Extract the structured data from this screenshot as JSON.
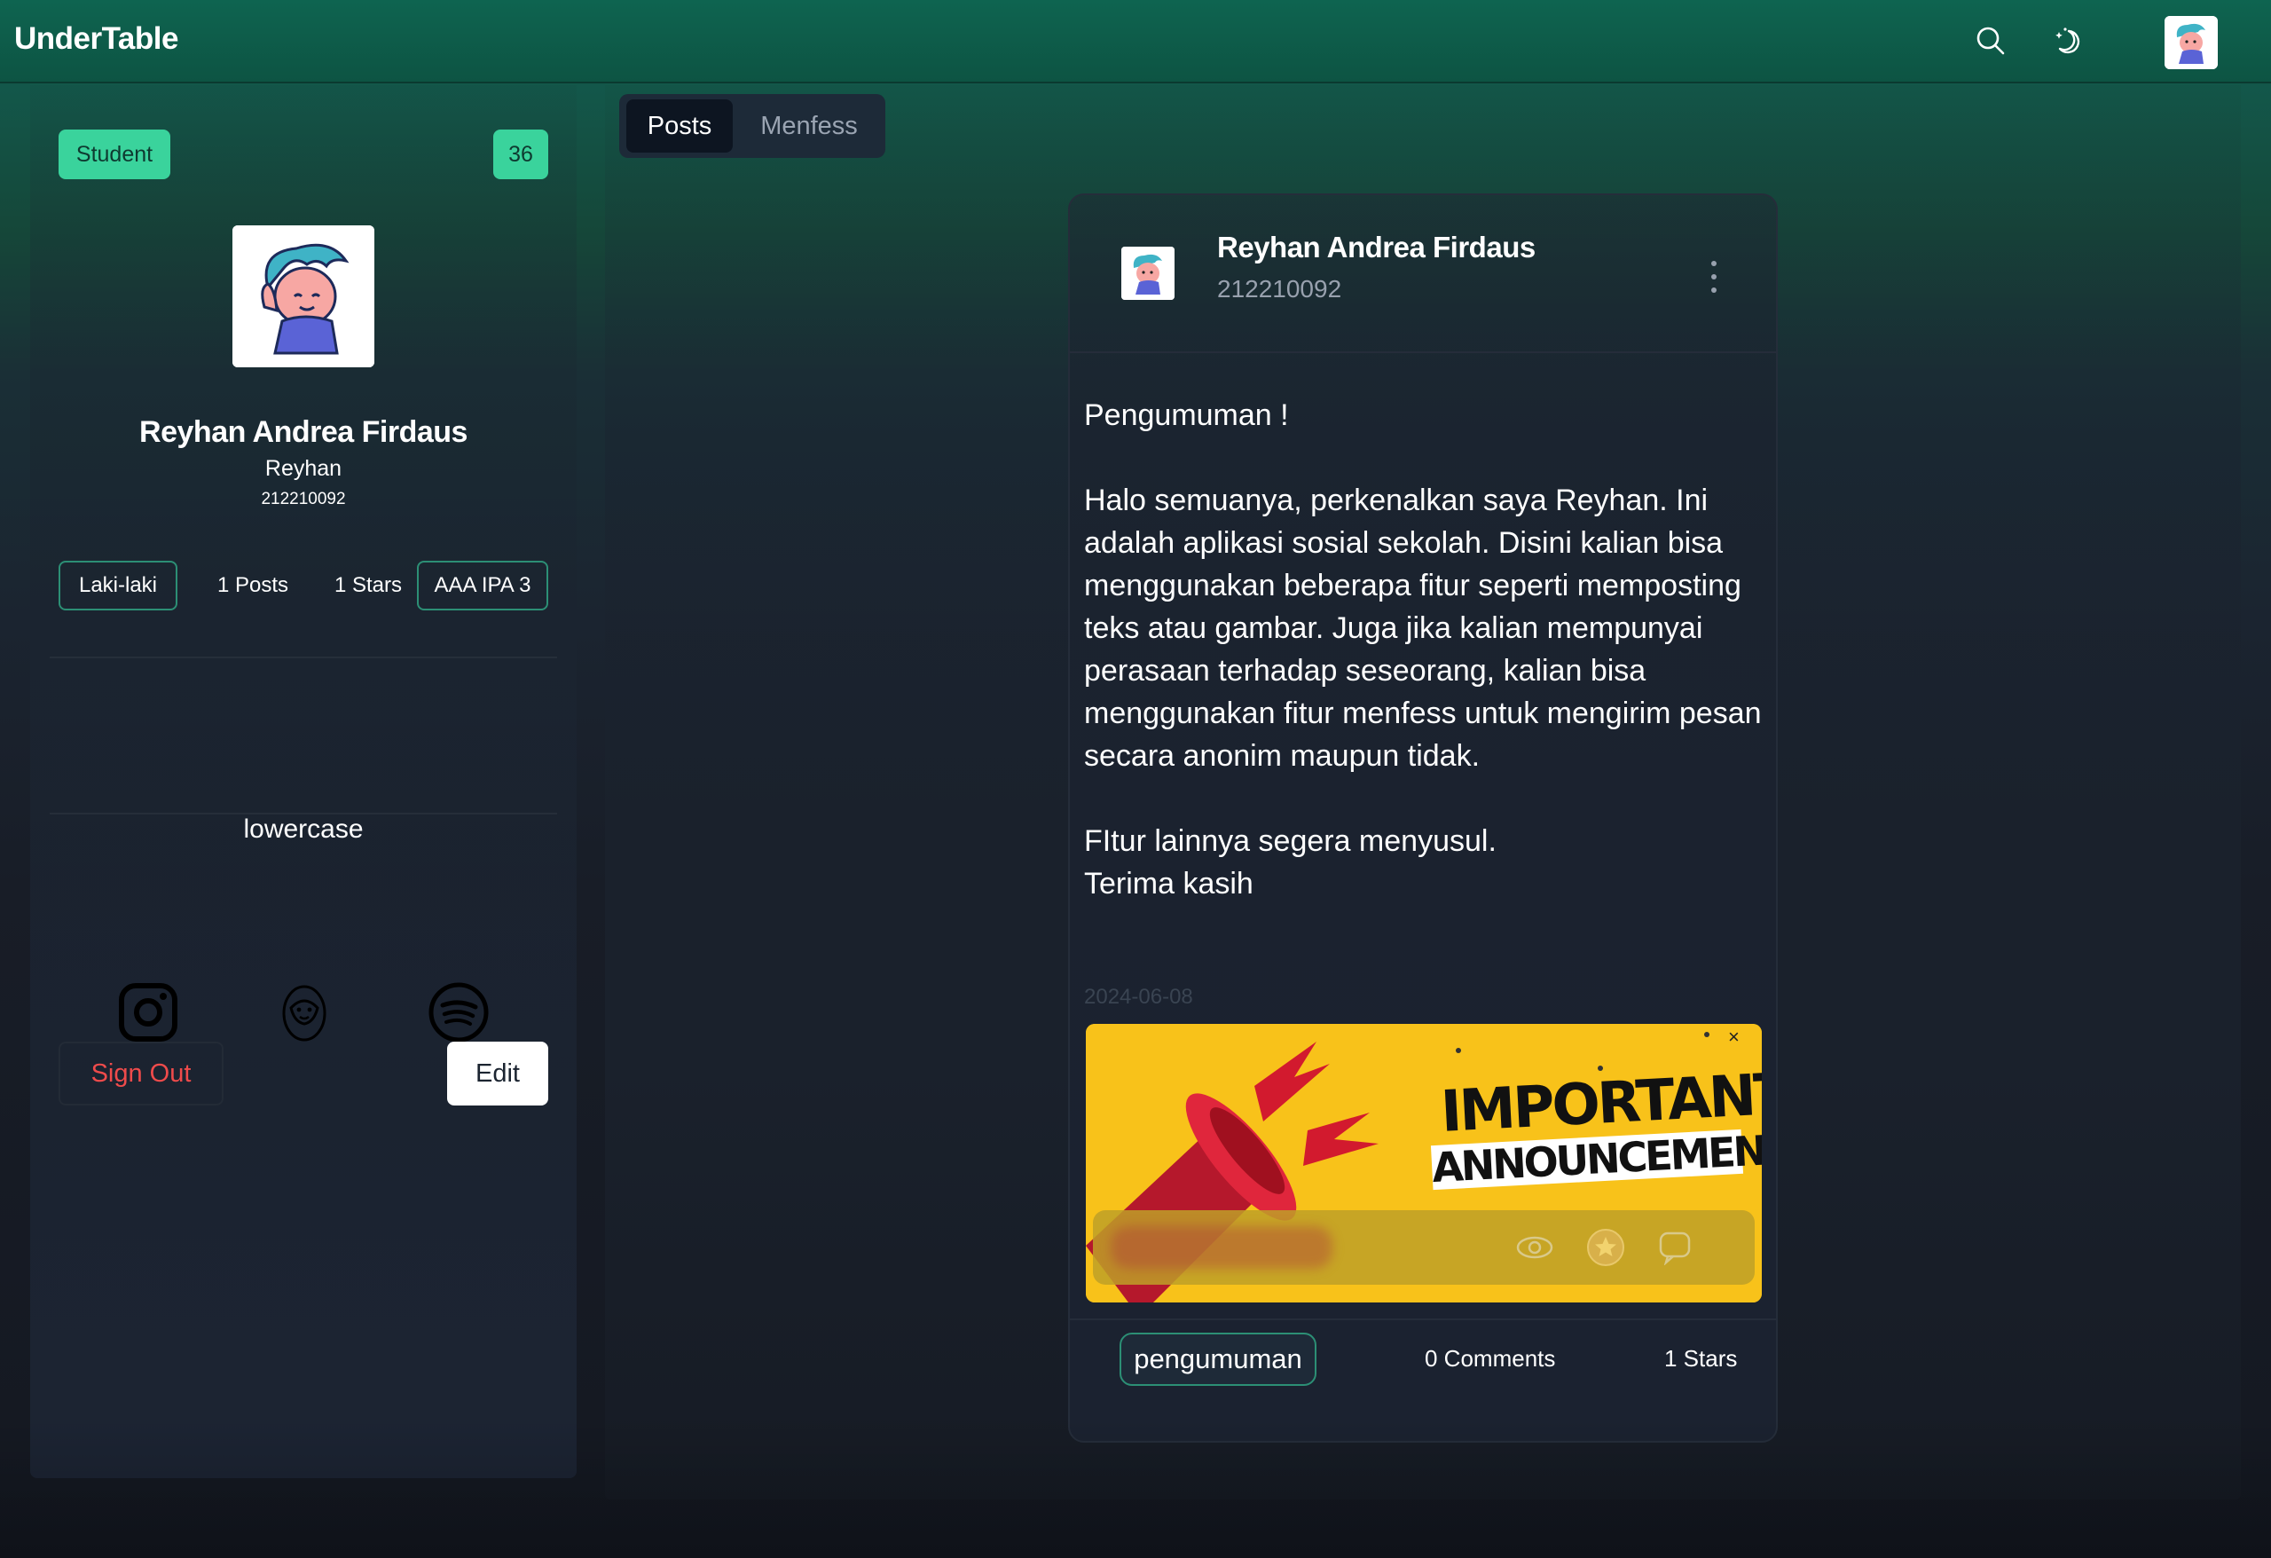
{
  "app": {
    "brand": "UnderTable"
  },
  "navbar": {
    "search_icon": "search-icon",
    "theme_icon": "moon-stars-icon",
    "avatar_icon": "user-avatar"
  },
  "sidebar": {
    "role_badge": "Student",
    "count_badge": "36",
    "name": "Reyhan Andrea Firdaus",
    "nickname": "Reyhan",
    "nis": "212210092",
    "stats": {
      "gender": "Laki-laki",
      "posts": "1 Posts",
      "stars": "1 Stars",
      "class": "AAA IPA 3"
    },
    "bio": "lowercase",
    "social_icons": [
      "instagram-icon",
      "face-icon",
      "spotify-icon"
    ],
    "signout_label": "Sign Out",
    "edit_label": "Edit"
  },
  "tabs": [
    {
      "label": "Posts",
      "active": true
    },
    {
      "label": "Menfess",
      "active": false
    }
  ],
  "post": {
    "author": "Reyhan Andrea Firdaus",
    "nis": "212210092",
    "body": "Pengumuman !\n\nHalo semuanya, perkenalkan saya Reyhan. Ini adalah aplikasi sosial sekolah. Disini kalian bisa menggunakan beberapa fitur seperti memposting teks atau gambar. Juga jika kalian mempunyai perasaan terhadap seseorang, kalian bisa menggunakan fitur menfess untuk mengirim pesan secara anonim maupun tidak.\n\nFItur lainnya segera menyusul.\nTerima kasih",
    "date": "2024-06-08",
    "image": {
      "line1": "IMPORTANT",
      "line2": "ANNOUNCEMENT",
      "close": "×"
    },
    "tag": "pengumuman",
    "comments": "0 Comments",
    "stars": "1 Stars"
  },
  "colors": {
    "accent": "#3ad39c",
    "signout": "#ef4b4b",
    "announcement_bg": "#f8c21a"
  }
}
